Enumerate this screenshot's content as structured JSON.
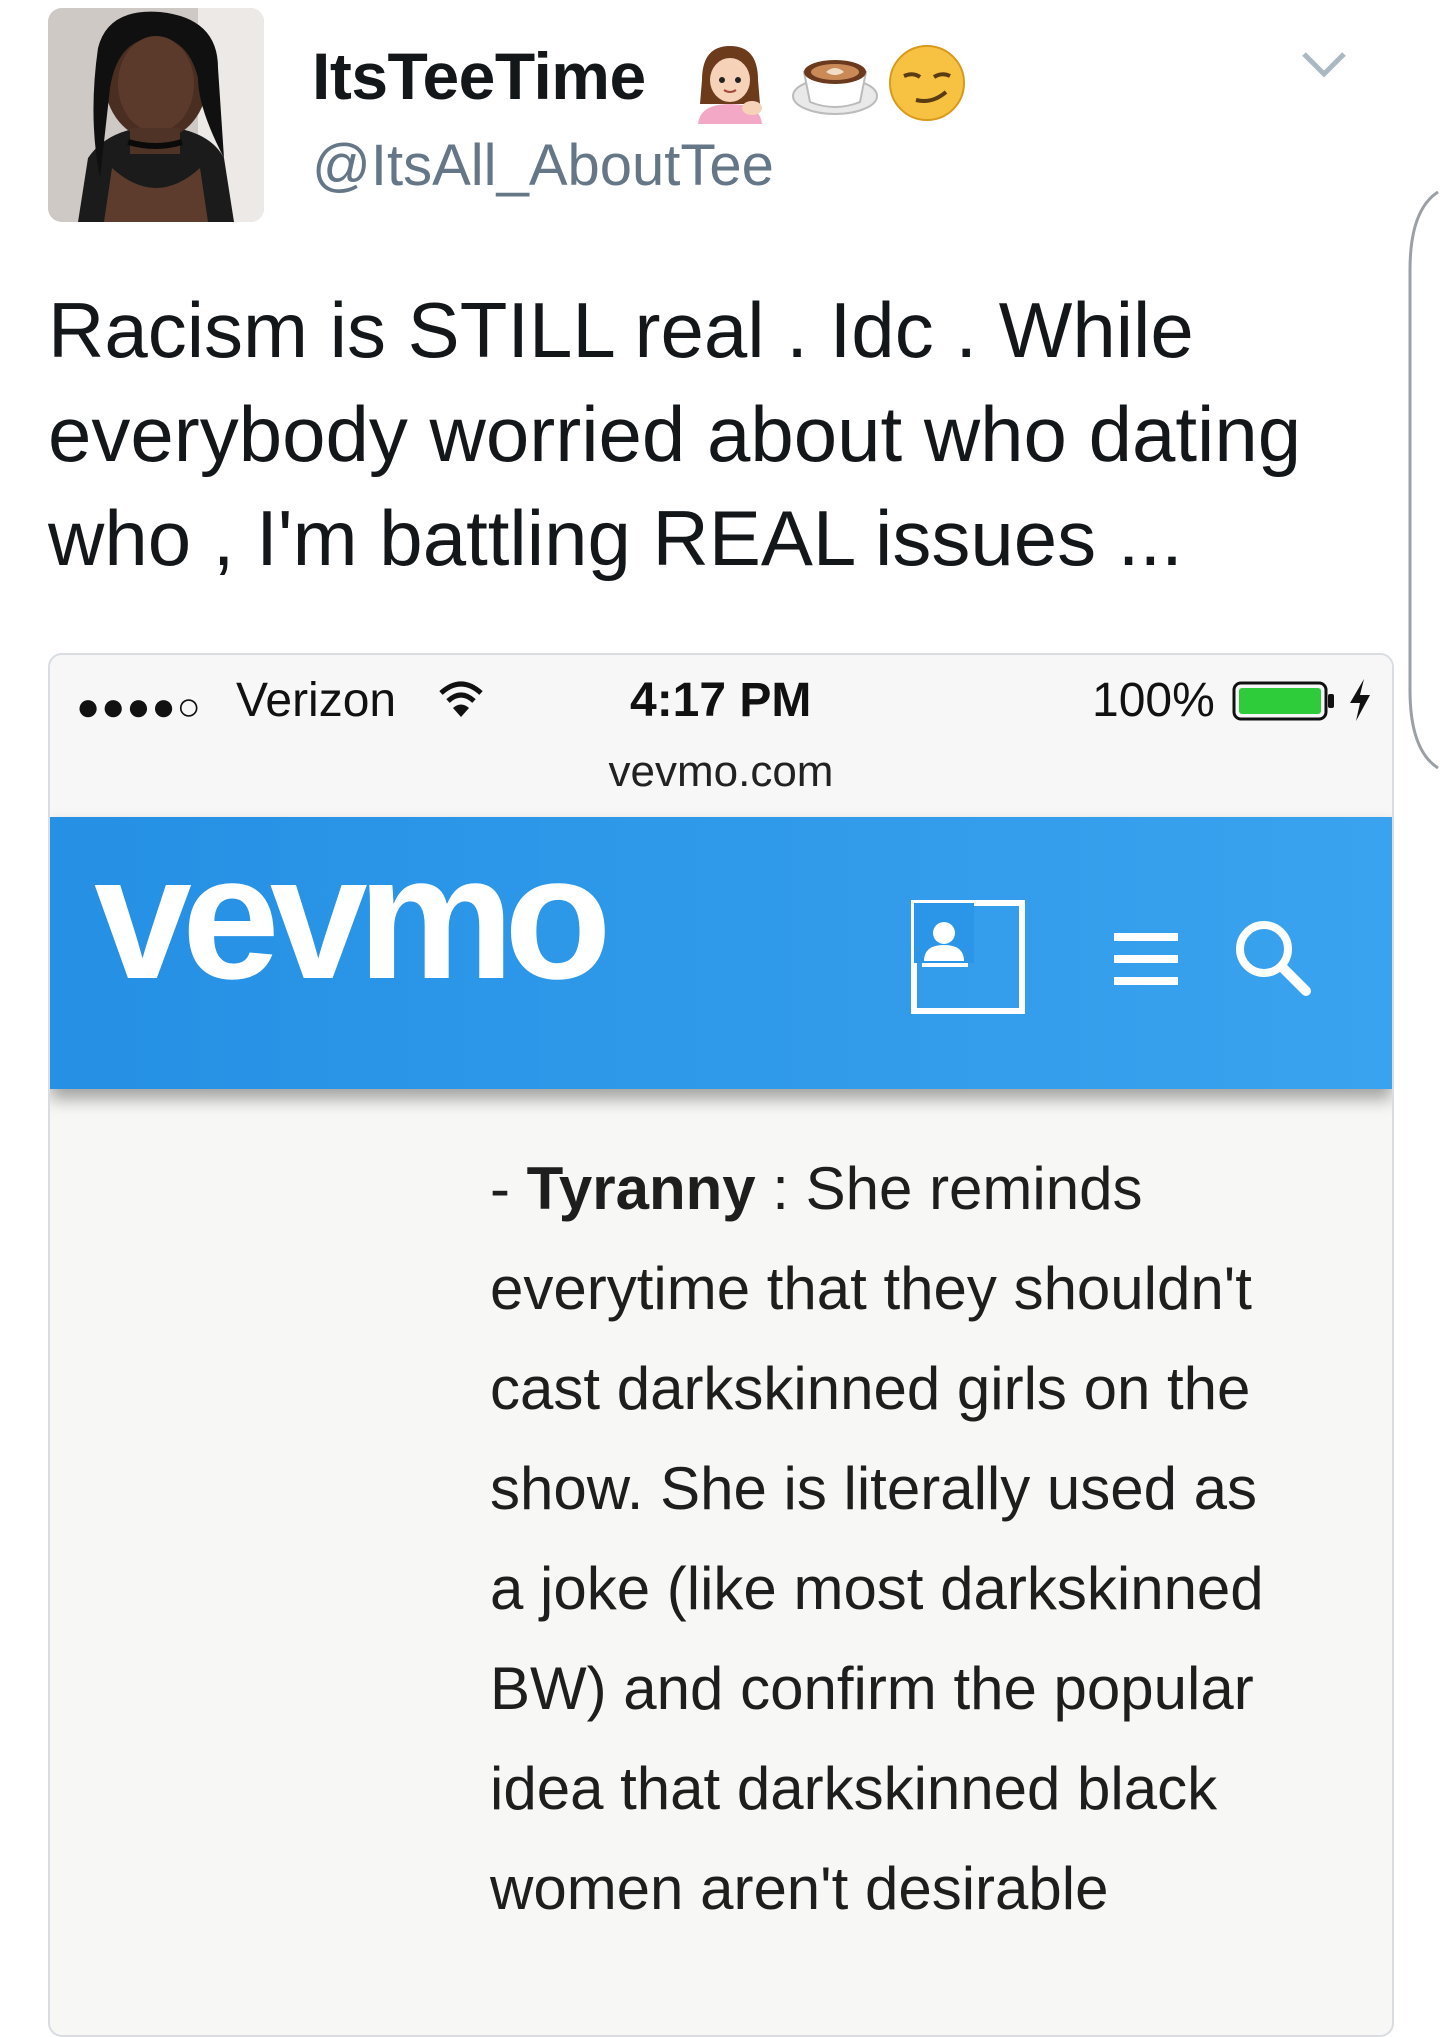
{
  "tweet": {
    "display_name": "ItsTeeTime",
    "name_emojis": [
      "woman-tipping-hand-emoji",
      "coffee-latte-emoji",
      "smirking-face-emoji"
    ],
    "handle": "@ItsAll_AboutTee",
    "text": "Racism is STILL real . Idc . While everybody worried about who dating who , I'm battling REAL issues ..."
  },
  "embedded_screenshot": {
    "status_bar": {
      "signal": "●●●●○",
      "carrier": "Verizon",
      "time": "4:17 PM",
      "battery": "100%"
    },
    "url": "vevmo.com",
    "site_logo": "vevmo",
    "article": {
      "lead": "- ",
      "term": "Tyranny",
      "body": " : She reminds everytime that they shouldn't cast darkskinned girls on the show. She is literally used as a joke (like most darkskinned BW) and confirm the popular idea that darkskinned black women aren't desirable"
    }
  },
  "colors": {
    "header_blue": "#2b96e8",
    "handle_gray": "#657786",
    "battery_green": "#2ecc3a"
  }
}
